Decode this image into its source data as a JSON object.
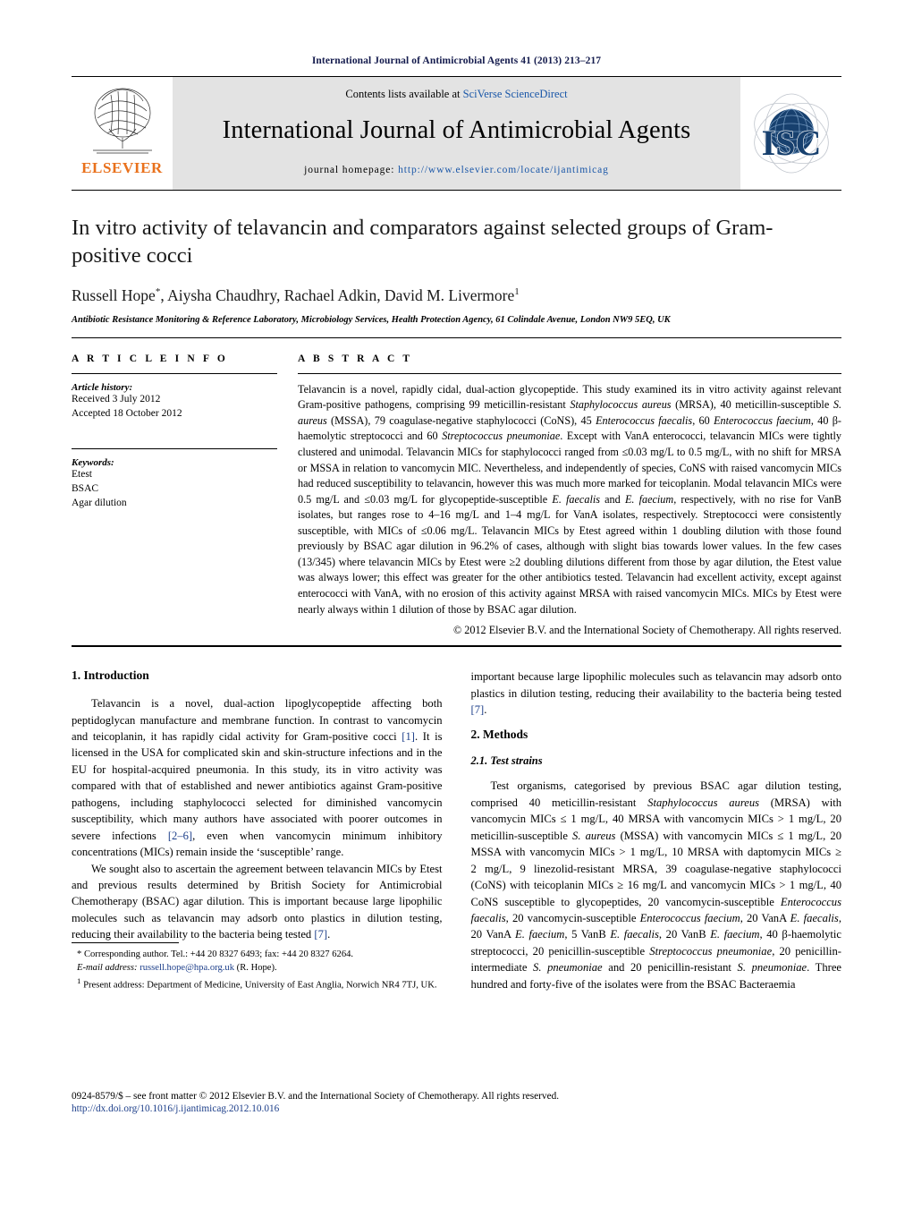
{
  "running_head": "International Journal of Antimicrobial Agents 41 (2013) 213–217",
  "masthead": {
    "contents_prefix": "Contents lists available at ",
    "contents_link": "SciVerse ScienceDirect",
    "journal_name": "International Journal of Antimicrobial Agents",
    "homepage_label": "journal homepage:",
    "homepage_url": "http://www.elsevier.com/locate/ijantimicag",
    "publisher_name": "ELSEVIER",
    "society_logo_text": "ISC",
    "link_color": "#1a57a8",
    "band_color": "#e3e3e3"
  },
  "title": "In vitro activity of telavancin and comparators against selected groups of Gram-positive cocci",
  "authors": "Russell Hope*, Aiysha Chaudhry, Rachael Adkin, David M. Livermore",
  "author_marks": {
    "corresponding": "*",
    "present_address": "1"
  },
  "affiliation": "Antibiotic Resistance Monitoring & Reference Laboratory, Microbiology Services, Health Protection Agency, 61 Colindale Avenue, London NW9 5EQ, UK",
  "article_info": {
    "heading": "A R T I C L E   I N F O",
    "history_label": "Article history:",
    "history": [
      "Received 3 July 2012",
      "Accepted 18 October 2012"
    ],
    "keywords_label": "Keywords:",
    "keywords": [
      "Etest",
      "BSAC",
      "Agar dilution"
    ]
  },
  "abstract": {
    "heading": "A B S T R A C T",
    "text": "Telavancin is a novel, rapidly cidal, dual-action glycopeptide. This study examined its in vitro activity against relevant Gram-positive pathogens, comprising 99 meticillin-resistant Staphylococcus aureus (MRSA), 40 meticillin-susceptible S. aureus (MSSA), 79 coagulase-negative staphylococci (CoNS), 45 Enterococcus faecalis, 60 Enterococcus faecium, 40 β-haemolytic streptococci and 60 Streptococcus pneumoniae. Except with VanA enterococci, telavancin MICs were tightly clustered and unimodal. Telavancin MICs for staphylococci ranged from ≤0.03 mg/L to 0.5 mg/L, with no shift for MRSA or MSSA in relation to vancomycin MIC. Nevertheless, and independently of species, CoNS with raised vancomycin MICs had reduced susceptibility to telavancin, however this was much more marked for teicoplanin. Modal telavancin MICs were 0.5 mg/L and ≤0.03 mg/L for glycopeptide-susceptible E. faecalis and E. faecium, respectively, with no rise for VanB isolates, but ranges rose to 4–16 mg/L and 1–4 mg/L for VanA isolates, respectively. Streptococci were consistently susceptible, with MICs of ≤0.06 mg/L. Telavancin MICs by Etest agreed within 1 doubling dilution with those found previously by BSAC agar dilution in 96.2% of cases, although with slight bias towards lower values. In the few cases (13/345) where telavancin MICs by Etest were ≥2 doubling dilutions different from those by agar dilution, the Etest value was always lower; this effect was greater for the other antibiotics tested. Telavancin had excellent activity, except against enterococci with VanA, with no erosion of this activity against MRSA with raised vancomycin MICs. MICs by Etest were nearly always within 1 dilution of those by BSAC agar dilution.",
    "copyright": "© 2012 Elsevier B.V. and the International Society of Chemotherapy. All rights reserved."
  },
  "sections": {
    "intro_heading": "1. Introduction",
    "intro_p1": "Telavancin is a novel, dual-action lipoglycopeptide affecting both peptidoglycan manufacture and membrane function. In contrast to vancomycin and teicoplanin, it has rapidly cidal activity for Gram-positive cocci [1]. It is licensed in the USA for complicated skin and skin-structure infections and in the EU for hospital-acquired pneumonia. In this study, its in vitro activity was compared with that of established and newer antibiotics against Gram-positive pathogens, including staphylococci selected for diminished vancomycin susceptibility, which many authors have associated with poorer outcomes in severe infections [2–6], even when vancomycin minimum inhibitory concentrations (MICs) remain inside the ‘susceptible’ range.",
    "intro_p2": "We sought also to ascertain the agreement between telavancin MICs by Etest and previous results determined by British Society for Antimicrobial Chemotherapy (BSAC) agar dilution. This is important because large lipophilic molecules such as telavancin may adsorb onto plastics in dilution testing, reducing their availability to the bacteria being tested [7].",
    "methods_heading": "2. Methods",
    "test_strains_heading": "2.1. Test strains",
    "test_strains_p1": "Test organisms, categorised by previous BSAC agar dilution testing, comprised 40 meticillin-resistant Staphylococcus aureus (MRSA) with vancomycin MICs ≤ 1 mg/L, 40 MRSA with vancomycin MICs > 1 mg/L, 20 meticillin-susceptible S. aureus (MSSA) with vancomycin MICs ≤ 1 mg/L, 20 MSSA with vancomycin MICs > 1 mg/L, 10 MRSA with daptomycin MICs ≥ 2 mg/L, 9 linezolid-resistant MRSA, 39 coagulase-negative staphylococci (CoNS) with teicoplanin MICs ≥ 16 mg/L and vancomycin MICs > 1 mg/L, 40 CoNS susceptible to glycopeptides, 20 vancomycin-susceptible Enterococcus faecalis, 20 vancomycin-susceptible Enterococcus faecium, 20 VanA E. faecalis, 20 VanA E. faecium, 5 VanB E. faecalis, 20 VanB E. faecium, 40 β-haemolytic streptococci, 20 penicillin-susceptible Streptococcus pneumoniae, 20 penicillin-intermediate S. pneumoniae and 20 penicillin-resistant S. pneumoniae. Three hundred and forty-five of the isolates were from the BSAC Bacteraemia"
  },
  "footnotes": {
    "corresponding": "* Corresponding author. Tel.: +44 20 8327 6493; fax: +44 20 8327 6264.",
    "email_label": "E-mail address:",
    "email": "russell.hope@hpa.org.uk",
    "email_attrib": "(R. Hope).",
    "present_address": "1 Present address: Department of Medicine, University of East Anglia, Norwich NR4 7TJ, UK."
  },
  "bottom": {
    "front_matter": "0924-8579/$ – see front matter © 2012 Elsevier B.V. and the International Society of Chemotherapy. All rights reserved.",
    "doi": "http://dx.doi.org/10.1016/j.ijantimicag.2012.10.016"
  }
}
